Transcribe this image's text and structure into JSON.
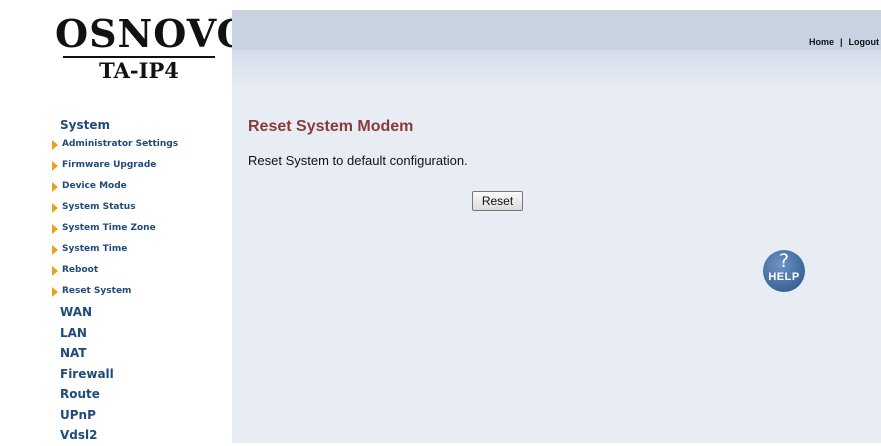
{
  "logo": {
    "brand": "OSNOVO",
    "model": "TA-IP4"
  },
  "topbar": {
    "home": "Home",
    "separator": "|",
    "logout": "Logout"
  },
  "sidebar": {
    "section": "System",
    "subitems": [
      "Administrator Settings",
      "Firmware Upgrade",
      "Device Mode",
      "System Status",
      "System Time Zone",
      "System Time",
      "Reboot",
      "Reset System"
    ],
    "mainitems": [
      "WAN",
      "LAN",
      "NAT",
      "Firewall",
      "Route",
      "UPnP",
      "Vdsl2"
    ]
  },
  "main": {
    "title": "Reset System Modem",
    "description": "Reset System to default configuration.",
    "reset_label": "Reset"
  },
  "help": {
    "symbol": "?",
    "label": "HELP"
  },
  "colors": {
    "title": "#8b3a3a",
    "nav": "#1f4a7a",
    "arrow": "#e8a21c",
    "topbar": "#c9d4e3",
    "content_bg": "#e8edf4"
  }
}
